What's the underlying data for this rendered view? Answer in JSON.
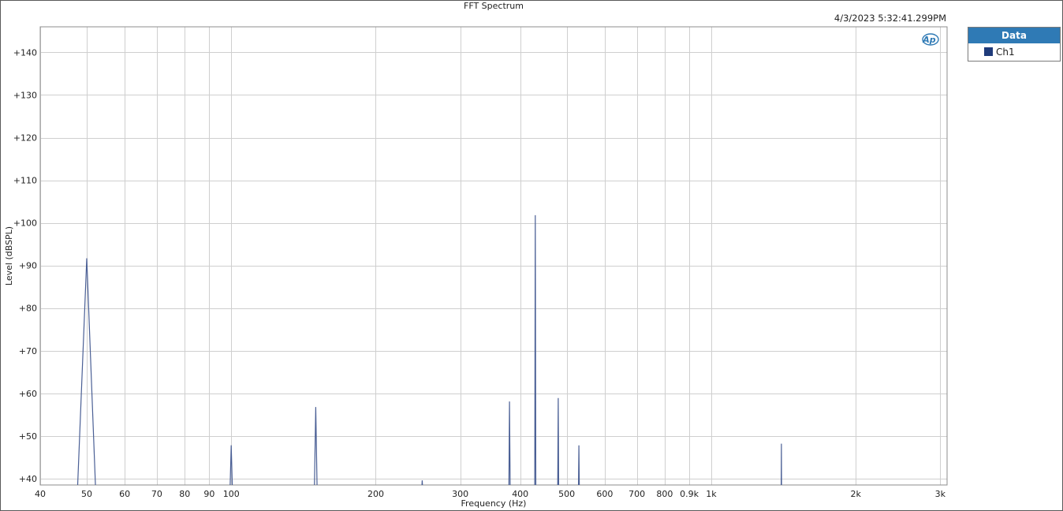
{
  "window": {
    "title": "FFT Spectrum",
    "timestamp": "4/3/2023 5:32:41.299PM"
  },
  "legend": {
    "header": "Data",
    "entries": [
      {
        "name": "Ch1",
        "color": "#1f3b7a"
      }
    ]
  },
  "logo": {
    "text": "Ap"
  },
  "chart_data": {
    "type": "line",
    "title": "FFT Spectrum",
    "xlabel": "Frequency (Hz)",
    "ylabel": "Level (dBSPL)",
    "xscale": "log",
    "xlim": [
      40,
      3100
    ],
    "ylim": [
      38.5,
      146
    ],
    "grid": true,
    "legend_position": "right-outside",
    "x_ticks": [
      {
        "value": 40,
        "label": "40"
      },
      {
        "value": 50,
        "label": "50"
      },
      {
        "value": 60,
        "label": "60"
      },
      {
        "value": 70,
        "label": "70"
      },
      {
        "value": 80,
        "label": "80"
      },
      {
        "value": 90,
        "label": "90"
      },
      {
        "value": 100,
        "label": "100"
      },
      {
        "value": 200,
        "label": "200"
      },
      {
        "value": 300,
        "label": "300"
      },
      {
        "value": 400,
        "label": "400"
      },
      {
        "value": 500,
        "label": "500"
      },
      {
        "value": 600,
        "label": "600"
      },
      {
        "value": 700,
        "label": "700"
      },
      {
        "value": 800,
        "label": "800"
      },
      {
        "value": 900,
        "label": "0.9k"
      },
      {
        "value": 1000,
        "label": "1k"
      },
      {
        "value": 2000,
        "label": "2k"
      },
      {
        "value": 3000,
        "label": "3k"
      }
    ],
    "y_ticks": [
      {
        "value": 40,
        "label": "+40"
      },
      {
        "value": 50,
        "label": "+50"
      },
      {
        "value": 60,
        "label": "+60"
      },
      {
        "value": 70,
        "label": "+70"
      },
      {
        "value": 80,
        "label": "+80"
      },
      {
        "value": 90,
        "label": "+90"
      },
      {
        "value": 100,
        "label": "+100"
      },
      {
        "value": 110,
        "label": "+110"
      },
      {
        "value": 120,
        "label": "+120"
      },
      {
        "value": 130,
        "label": "+130"
      },
      {
        "value": 140,
        "label": "+140"
      }
    ],
    "series": [
      {
        "name": "Ch1",
        "color": "#4a5f95",
        "peaks": [
          {
            "x": 50,
            "y": 91.7,
            "halfwidth": 2.2
          },
          {
            "x": 100,
            "y": 47.8,
            "halfwidth": 0.6
          },
          {
            "x": 150,
            "y": 56.8,
            "halfwidth": 1.0
          },
          {
            "x": 250,
            "y": 39.6,
            "halfwidth": 0.8
          },
          {
            "x": 380,
            "y": 58.1,
            "halfwidth": 1.2
          },
          {
            "x": 430,
            "y": 101.8,
            "halfwidth": 1.2
          },
          {
            "x": 480,
            "y": 58.9,
            "halfwidth": 1.2
          },
          {
            "x": 530,
            "y": 47.8,
            "halfwidth": 1.2
          },
          {
            "x": 1400,
            "y": 48.2,
            "halfwidth": 1.5
          }
        ]
      }
    ]
  }
}
